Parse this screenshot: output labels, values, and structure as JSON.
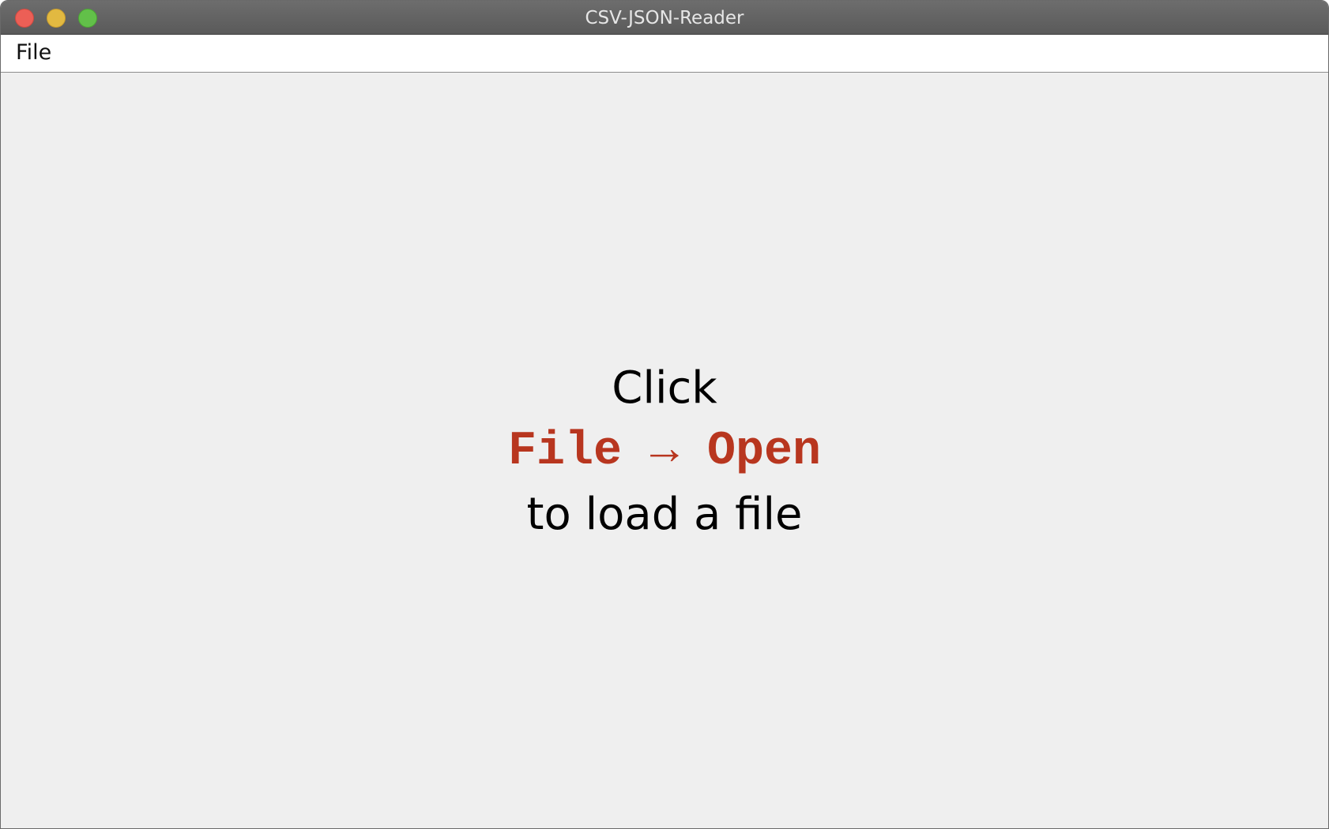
{
  "window": {
    "title": "CSV-JSON-Reader",
    "controls": {
      "close": "close-button",
      "minimize": "minimize-button",
      "zoom": "zoom-button"
    }
  },
  "menubar": {
    "items": [
      {
        "label": "File"
      }
    ]
  },
  "main": {
    "hint_line1": "Click",
    "hint_line2": "File → Open",
    "hint_line3": "to load a file"
  },
  "colors": {
    "hint_accent": "#b8361f",
    "background": "#efefef"
  }
}
